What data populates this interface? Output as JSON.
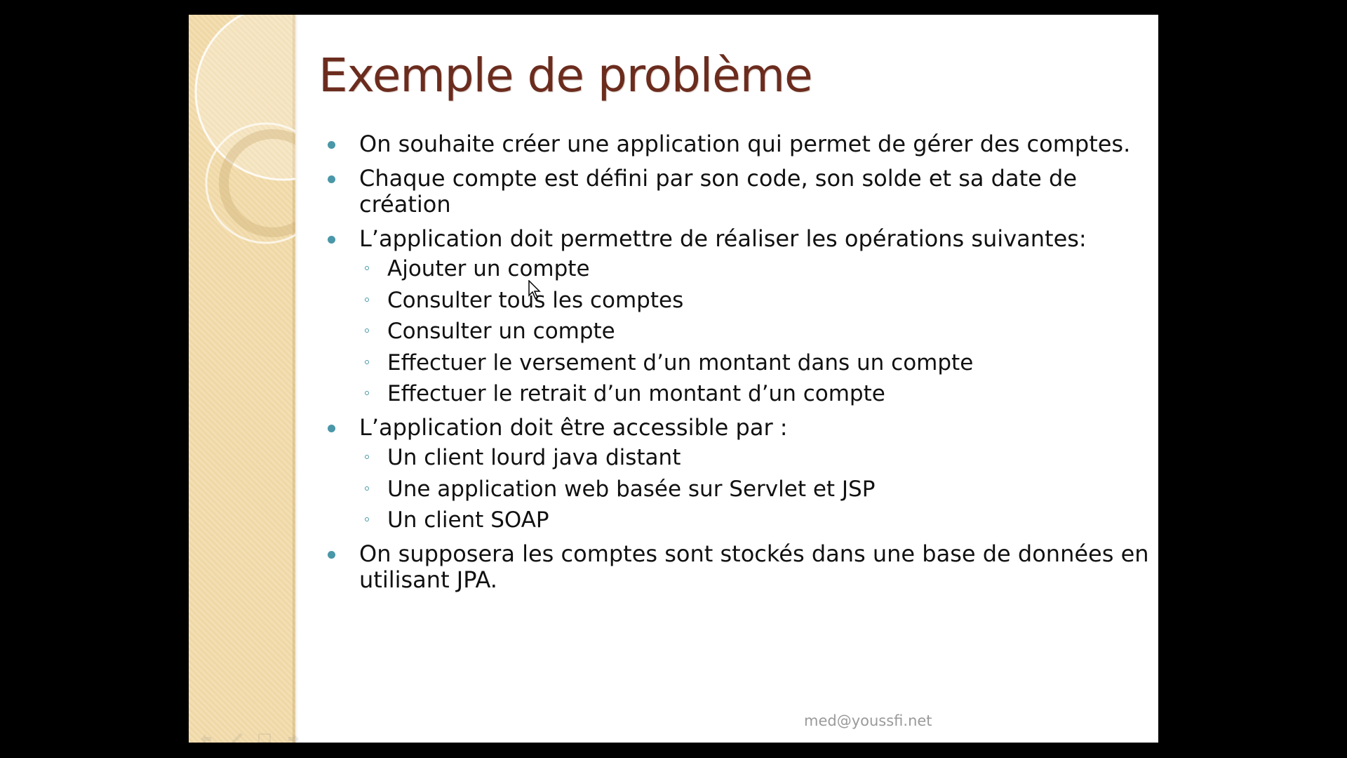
{
  "slide": {
    "title": "Exemple de problème",
    "footer": "med@youssfi.net",
    "items": [
      {
        "text": "On souhaite créer une application qui permet de gérer des comptes.",
        "subitems": []
      },
      {
        "text": "Chaque compte est défini par son code, son solde et sa date de création",
        "subitems": []
      },
      {
        "text": "L’application doit permettre de réaliser les opérations suivantes:",
        "subitems": [
          "Ajouter un compte",
          "Consulter tous les comptes",
          "Consulter un compte",
          "Effectuer le versement d’un montant dans un compte",
          "Effectuer  le retrait d’un montant d’un compte"
        ]
      },
      {
        "text": "L’application doit être accessible par :",
        "subitems": [
          "Un client lourd java distant",
          "Une application web basée sur Servlet et JSP",
          "Un client SOAP"
        ]
      },
      {
        "text": "On supposera les comptes sont stockés dans une base de données en utilisant JPA.",
        "subitems": []
      }
    ]
  },
  "colors": {
    "title": "#6b2c1e",
    "bullet": "#4a97a8",
    "band": "#f3dfb3",
    "background": "#000000"
  },
  "icons": {
    "bullet": "filled-circle",
    "sub_bullet": "hollow-circle",
    "pointer": "mouse-cursor-icon"
  }
}
